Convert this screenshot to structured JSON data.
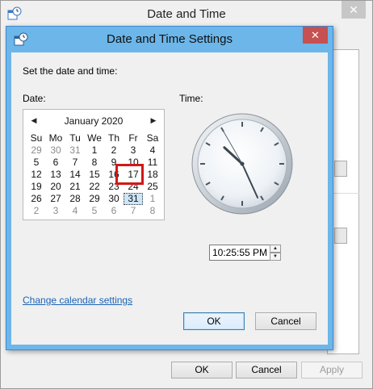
{
  "parent": {
    "title": "Date and Time",
    "close_glyph": "✕",
    "buttons": {
      "ok": "OK",
      "cancel": "Cancel",
      "apply": "Apply"
    }
  },
  "dialog": {
    "title": "Date and Time Settings",
    "close_glyph": "✕",
    "heading": "Set the date and time:",
    "date_label": "Date:",
    "time_label": "Time:",
    "change_calendar_link": "Change calendar settings",
    "ok_label": "OK",
    "cancel_label": "Cancel"
  },
  "calendar": {
    "month_label": "January 2020",
    "prev_glyph": "◀",
    "next_glyph": "▶",
    "weekdays": [
      "Su",
      "Mo",
      "Tu",
      "We",
      "Th",
      "Fr",
      "Sa"
    ],
    "weeks": [
      [
        {
          "d": "29",
          "o": true
        },
        {
          "d": "30",
          "o": true
        },
        {
          "d": "31",
          "o": true
        },
        {
          "d": "1"
        },
        {
          "d": "2"
        },
        {
          "d": "3"
        },
        {
          "d": "4"
        }
      ],
      [
        {
          "d": "5"
        },
        {
          "d": "6"
        },
        {
          "d": "7"
        },
        {
          "d": "8"
        },
        {
          "d": "9"
        },
        {
          "d": "10"
        },
        {
          "d": "11"
        }
      ],
      [
        {
          "d": "12"
        },
        {
          "d": "13"
        },
        {
          "d": "14"
        },
        {
          "d": "15"
        },
        {
          "d": "16"
        },
        {
          "d": "17"
        },
        {
          "d": "18"
        }
      ],
      [
        {
          "d": "19"
        },
        {
          "d": "20"
        },
        {
          "d": "21"
        },
        {
          "d": "22"
        },
        {
          "d": "23"
        },
        {
          "d": "24"
        },
        {
          "d": "25"
        }
      ],
      [
        {
          "d": "26"
        },
        {
          "d": "27"
        },
        {
          "d": "28"
        },
        {
          "d": "29"
        },
        {
          "d": "30"
        },
        {
          "d": "31",
          "s": true
        },
        {
          "d": "1",
          "o": true
        }
      ],
      [
        {
          "d": "2",
          "o": true
        },
        {
          "d": "3",
          "o": true
        },
        {
          "d": "4",
          "o": true
        },
        {
          "d": "5",
          "o": true
        },
        {
          "d": "6",
          "o": true
        },
        {
          "d": "7",
          "o": true
        },
        {
          "d": "8",
          "o": true
        }
      ]
    ]
  },
  "time": {
    "value": "10:25:55 PM",
    "hour": 10,
    "minute": 25,
    "second": 55
  },
  "colors": {
    "dialog_titlebar": "#6cb6ea",
    "close_button": "#c75050",
    "highlight_box": "#d11818",
    "link": "#1a63b7"
  }
}
